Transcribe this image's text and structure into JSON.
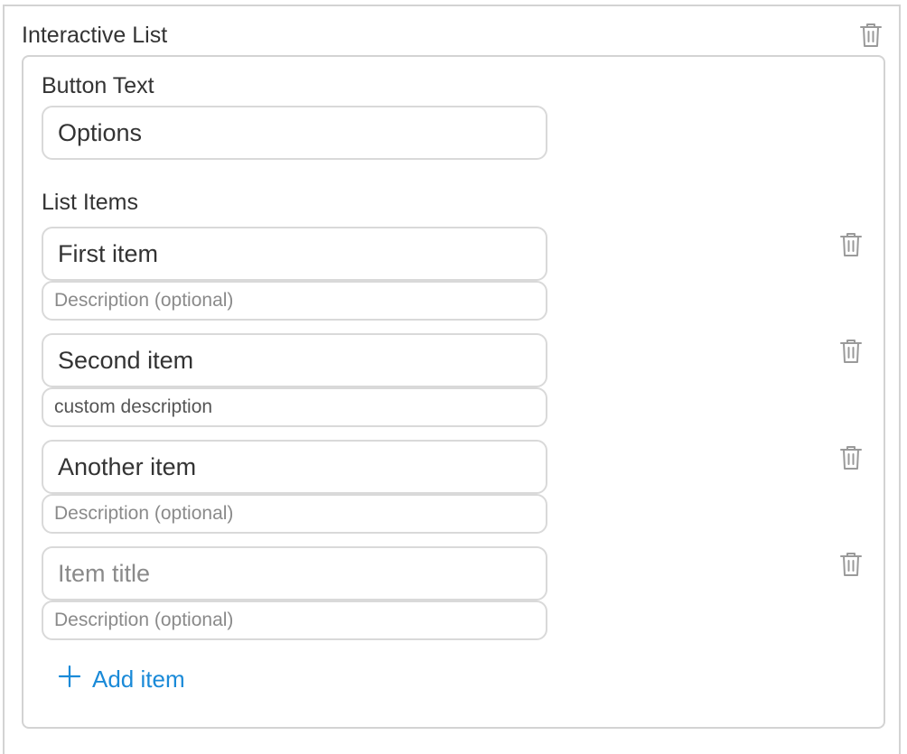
{
  "section": {
    "title": "Interactive List",
    "delete_icon": "trash-icon"
  },
  "button_text": {
    "label": "Button Text",
    "value": "Options"
  },
  "list": {
    "label": "List Items",
    "items": [
      {
        "title": "First item",
        "title_placeholder": "Item title",
        "description": "",
        "description_placeholder": "Description (optional)"
      },
      {
        "title": "Second item",
        "title_placeholder": "Item title",
        "description": "custom description",
        "description_placeholder": "Description (optional)"
      },
      {
        "title": "Another item",
        "title_placeholder": "Item title",
        "description": "",
        "description_placeholder": "Description (optional)"
      },
      {
        "title": "",
        "title_placeholder": "Item title",
        "description": "",
        "description_placeholder": "Description (optional)"
      }
    ],
    "add_label": "Add item",
    "add_icon": "plus-icon"
  },
  "colors": {
    "border": "#d3d3d3",
    "text": "#333333",
    "accent": "#1a8ad8",
    "icon": "#9a9a9a"
  }
}
